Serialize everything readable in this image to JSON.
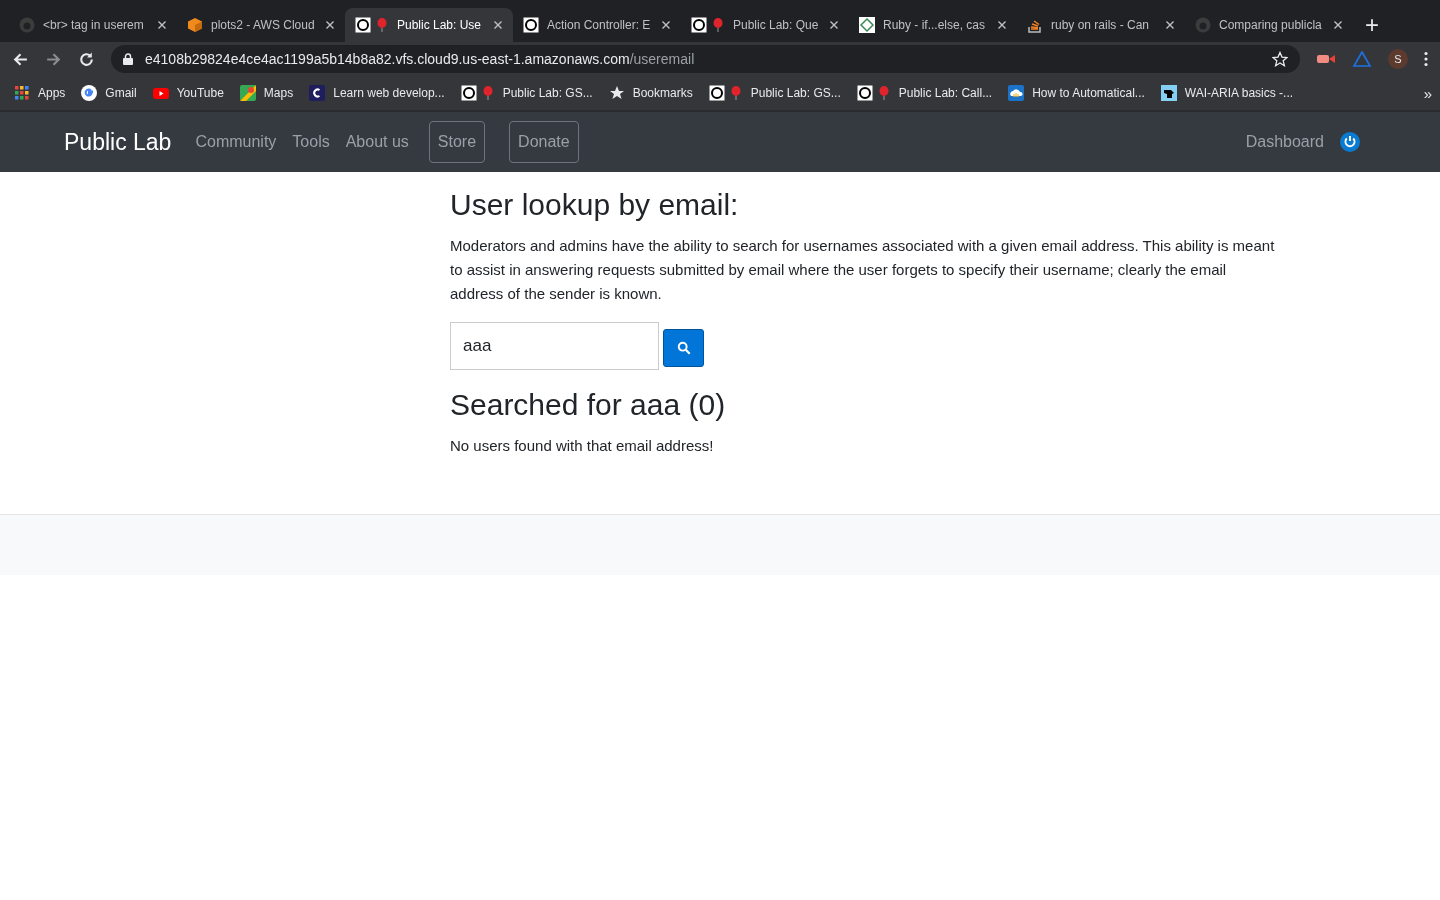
{
  "tabs": [
    {
      "title": "<br> tag in userem",
      "kind": "github",
      "selected": false
    },
    {
      "title": "plots2 - AWS Cloud",
      "kind": "cube",
      "selected": false
    },
    {
      "title": "Public Lab: Use",
      "kind": "publiclab",
      "selected": true
    },
    {
      "title": "Action Controller: E",
      "kind": "rails",
      "selected": false
    },
    {
      "title": "Public Lab: Que",
      "kind": "publiclab",
      "selected": false
    },
    {
      "title": "Ruby - if...else, cas",
      "kind": "ruby",
      "selected": false
    },
    {
      "title": "ruby on rails - Can",
      "kind": "stack",
      "selected": false
    },
    {
      "title": "Comparing publicla",
      "kind": "github",
      "selected": false
    }
  ],
  "new_tab": "+",
  "address": {
    "host": "e4108b29824e4ce4ac1199a5b14b8a82.vfs.cloud9.us-east-1.amazonaws.com",
    "path": "/useremail"
  },
  "profile": "S",
  "bookmarks": [
    {
      "label": "Apps",
      "kind": "apps"
    },
    {
      "label": "Gmail",
      "kind": "google"
    },
    {
      "label": "YouTube",
      "kind": "youtube"
    },
    {
      "label": "Maps",
      "kind": "maps"
    },
    {
      "label": "Learn web develop...",
      "kind": "codecademy"
    },
    {
      "label": "Public Lab: GS...",
      "kind": "publiclab"
    },
    {
      "label": "Bookmarks",
      "kind": "star"
    },
    {
      "label": "Public Lab: GS...",
      "kind": "publiclab"
    },
    {
      "label": "Public Lab: Call...",
      "kind": "publiclab"
    },
    {
      "label": "How to Automatical...",
      "kind": "cloud"
    },
    {
      "label": "WAI-ARIA basics -...",
      "kind": "mdn"
    }
  ],
  "more_bookmarks": "»",
  "navbar": {
    "brand": "Public Lab",
    "links": [
      {
        "label": "Community",
        "kind": "link"
      },
      {
        "label": "Tools",
        "kind": "link"
      },
      {
        "label": "About us",
        "kind": "link"
      },
      {
        "label": "Store",
        "kind": "outline"
      },
      {
        "label": "Donate",
        "kind": "outline"
      }
    ],
    "dashboard": "Dashboard"
  },
  "page": {
    "heading": "User lookup by email:",
    "intro": "Moderators and admins have the ability to search for usernames associated with a given email address. This ability is meant to assist in answering requests submitted by email where the user forgets to specify their username; clearly the email address of the sender is known.",
    "search_value": "aaa",
    "result_heading": "Searched for aaa (0)",
    "result_message": "No users found with that email address!"
  }
}
